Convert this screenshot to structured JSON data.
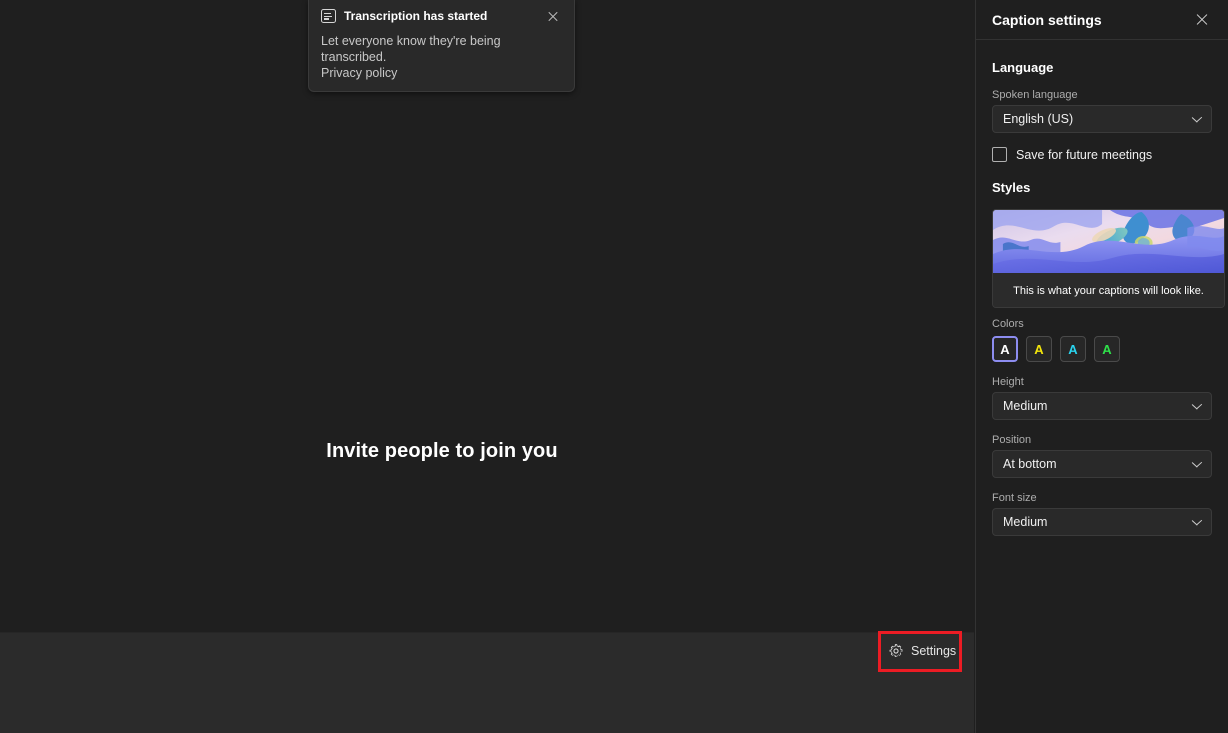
{
  "stage": {
    "invite_text": "Invite people to join you"
  },
  "toast": {
    "icon": "transcript-icon",
    "title": "Transcription has started",
    "body": "Let everyone know they're being transcribed.",
    "link": "Privacy policy",
    "close_icon": "close-icon"
  },
  "bottombar": {
    "settings_label": "Settings",
    "settings_icon": "gear-icon",
    "highlight_color": "#ec1c24"
  },
  "panel": {
    "title": "Caption settings",
    "close_icon": "close-icon",
    "language": {
      "section_title": "Language",
      "spoken_language_label": "Spoken language",
      "spoken_language_value": "English (US)",
      "save_checkbox_label": "Save for future meetings",
      "save_checkbox_checked": false
    },
    "styles": {
      "section_title": "Styles",
      "preview_caption": "This is what your captions will look like.",
      "colors_label": "Colors",
      "colors": [
        {
          "name": "white",
          "letter": "A",
          "hex": "#ffffff",
          "selected": true
        },
        {
          "name": "yellow",
          "letter": "A",
          "hex": "#f2e40b",
          "selected": false
        },
        {
          "name": "cyan",
          "letter": "A",
          "hex": "#2ad4ef",
          "selected": false
        },
        {
          "name": "green",
          "letter": "A",
          "hex": "#2fe04a",
          "selected": false
        }
      ],
      "height_label": "Height",
      "height_value": "Medium",
      "position_label": "Position",
      "position_value": "At bottom",
      "font_size_label": "Font size",
      "font_size_value": "Medium"
    }
  }
}
